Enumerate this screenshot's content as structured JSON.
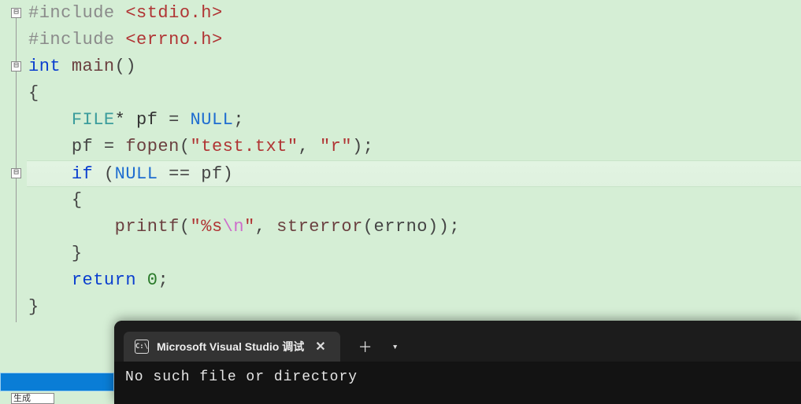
{
  "code": {
    "directive": "#include",
    "stdio": "<stdio.h>",
    "errno_h": "<errno.h>",
    "kw_int": "int",
    "fn_main": "main",
    "parens": "()",
    "lbrace": "{",
    "rbrace": "}",
    "type_FILE": "FILE",
    "star_pf": "* pf ",
    "eq": "= ",
    "NULL": "NULL",
    "semi": ";",
    "pf_assign_pre": "pf ",
    "fn_fopen": "fopen",
    "lparen": "(",
    "rparen": ")",
    "str_test": "\"test.txt\"",
    "comma_sp": ", ",
    "str_r": "\"r\"",
    "kw_if": "if",
    "sp_lparen": " (",
    "op_eqeq": " == ",
    "pf_ident": "pf",
    "fn_printf": "printf",
    "str_fmt_q": "\"",
    "str_fmt_body": "%s",
    "str_fmt_escape": "\\n",
    "fn_strerror": "strerror",
    "ident_errno": "errno",
    "rparen_rparen_semi": "));",
    "kw_return": "return",
    "sp": " ",
    "num_zero": "0"
  },
  "indent": {
    "l1": "    ",
    "l2": "        "
  },
  "console": {
    "tab_title": "Microsoft Visual Studio 调试",
    "cmd_glyph": "C:\\",
    "output_line1": "No such file or directory"
  },
  "bottom": {
    "label": "生成"
  },
  "fold": {
    "minus": "⊟"
  }
}
